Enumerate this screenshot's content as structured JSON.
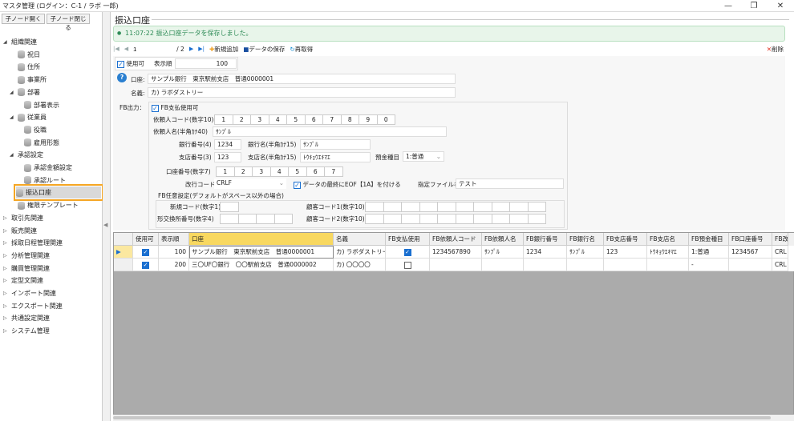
{
  "window": {
    "title": "マスタ管理 (ログイン：C-1 / ラボ 一郎)",
    "min": "—",
    "max": "❐",
    "close": "✕"
  },
  "sidebar": {
    "expand_label": "子ノード開く",
    "collapse_label": "子ノード閉じる",
    "items": [
      {
        "label": "組織関連",
        "level": 0,
        "type": "open"
      },
      {
        "label": "祝日",
        "level": 2,
        "type": "leaf"
      },
      {
        "label": "住所",
        "level": 2,
        "type": "leaf"
      },
      {
        "label": "事業所",
        "level": 2,
        "type": "leaf"
      },
      {
        "label": "部署",
        "level": 1,
        "type": "openleaf"
      },
      {
        "label": "部署表示",
        "level": 3,
        "type": "leaf"
      },
      {
        "label": "従業員",
        "level": 1,
        "type": "openleaf"
      },
      {
        "label": "役職",
        "level": 3,
        "type": "leaf"
      },
      {
        "label": "雇用形態",
        "level": 3,
        "type": "leaf"
      },
      {
        "label": "承認設定",
        "level": 1,
        "type": "open"
      },
      {
        "label": "承認金額設定",
        "level": 3,
        "type": "leaf"
      },
      {
        "label": "承認ルート",
        "level": 3,
        "type": "leaf"
      },
      {
        "label": "振込口座",
        "level": 2,
        "type": "leaf",
        "selected": true
      },
      {
        "label": "権限テンプレート",
        "level": 2,
        "type": "leaf"
      },
      {
        "label": "取引先関連",
        "level": 0,
        "type": "closed"
      },
      {
        "label": "販売関連",
        "level": 0,
        "type": "closed"
      },
      {
        "label": "採取日程管理関連",
        "level": 0,
        "type": "closed"
      },
      {
        "label": "分析管理関連",
        "level": 0,
        "type": "closed"
      },
      {
        "label": "購買管理関連",
        "level": 0,
        "type": "closed"
      },
      {
        "label": "定型文関連",
        "level": 0,
        "type": "closed"
      },
      {
        "label": "インポート関連",
        "level": 0,
        "type": "closed"
      },
      {
        "label": "エクスポート関連",
        "level": 0,
        "type": "closed"
      },
      {
        "label": "共通設定関連",
        "level": 0,
        "type": "closed"
      },
      {
        "label": "システム管理",
        "level": 0,
        "type": "closed"
      }
    ]
  },
  "main": {
    "title": "振込口座",
    "message": "11:07:22 振込口座データを保存しました。",
    "toolbar": {
      "page": "1",
      "total": "/ 2",
      "add": "新規追加",
      "save": "データの保存",
      "reload": "再取得",
      "delete": "削除"
    }
  },
  "form": {
    "enabled_label": "使用可",
    "order_label": "表示順",
    "order": "100",
    "account_label": "口座:",
    "account": "サンプル銀行　東京駅前支店　普通0000001",
    "holder_label": "名義:",
    "holder": "カ) ラボダストリー",
    "fb_label": "FB出力：",
    "fb_enable": "FB支払使用可",
    "requester_code_label": "依頼人コード(数字10)",
    "requester_code": [
      "1",
      "2",
      "3",
      "4",
      "5",
      "6",
      "7",
      "8",
      "9",
      "0"
    ],
    "requester_name_label": "依頼人名(半角ｶﾅ40)",
    "requester_name": "ｻﾝﾌﾟﾙ",
    "bank_no_label": "銀行番号(4)",
    "bank_no": "1234",
    "bank_name_label": "銀行名(半角ｶﾅ15)",
    "bank_name": "ｻﾝﾌﾟﾙ",
    "branch_no_label": "支店番号(3)",
    "branch_no": "123",
    "branch_name_label": "支店名(半角ｶﾅ15)",
    "branch_name": "ﾄｳｷｮｳｴｷﾏｴ",
    "deposit_label": "預金種目",
    "deposit": "1:普通",
    "account_no_label": "口座番号(数字7)",
    "account_no": [
      "1",
      "2",
      "3",
      "4",
      "5",
      "6",
      "7"
    ],
    "newline_label": "改行コード",
    "newline": "CRLF",
    "eof_label": "データの最終にEOF【1A】を付ける",
    "filename_label": "指定ファイル名",
    "filename": "テスト",
    "optional_label": "FB任意設定(デフォルトがスペース以外の場合)",
    "new_code_label": "新規コード(数字1)",
    "exchange_label": "形交換所番号(数字4)",
    "cust1_label": "顧客コード1(数字10)",
    "cust2_label": "顧客コード2(数字10)"
  },
  "grid": {
    "columns": [
      "使用可",
      "表示順",
      "口座",
      "名義",
      "FB支払使用",
      "FB依頼人コード",
      "FB依頼人名",
      "FB銀行番号",
      "FB銀行名",
      "FB支店番号",
      "FB支店名",
      "FB預金種目",
      "FB口座番号",
      "FB改"
    ],
    "rows": [
      {
        "enabled": true,
        "order": "100",
        "account": "サンプル銀行　東京駅前支店　普通0000001",
        "holder": "カ) ラボダストリー",
        "fb": true,
        "req_code": "1234567890",
        "req_name": "ｻﾝﾌﾟﾙ",
        "bank_no": "1234",
        "bank_name": "ｻﾝﾌﾟﾙ",
        "branch_no": "123",
        "branch_name": "ﾄｳｷｮｳｴｷﾏｴ",
        "deposit": "1:普通",
        "acct_no": "1234567",
        "newline": "CRL"
      },
      {
        "enabled": true,
        "order": "200",
        "account": "三〇UF〇銀行　〇〇駅前支店　普通0000002",
        "holder": "カ) 〇〇〇〇",
        "fb": false,
        "req_code": "",
        "req_name": "",
        "bank_no": "",
        "bank_name": "",
        "branch_no": "",
        "branch_name": "",
        "deposit": "-",
        "acct_no": "",
        "newline": "CRL"
      }
    ]
  }
}
